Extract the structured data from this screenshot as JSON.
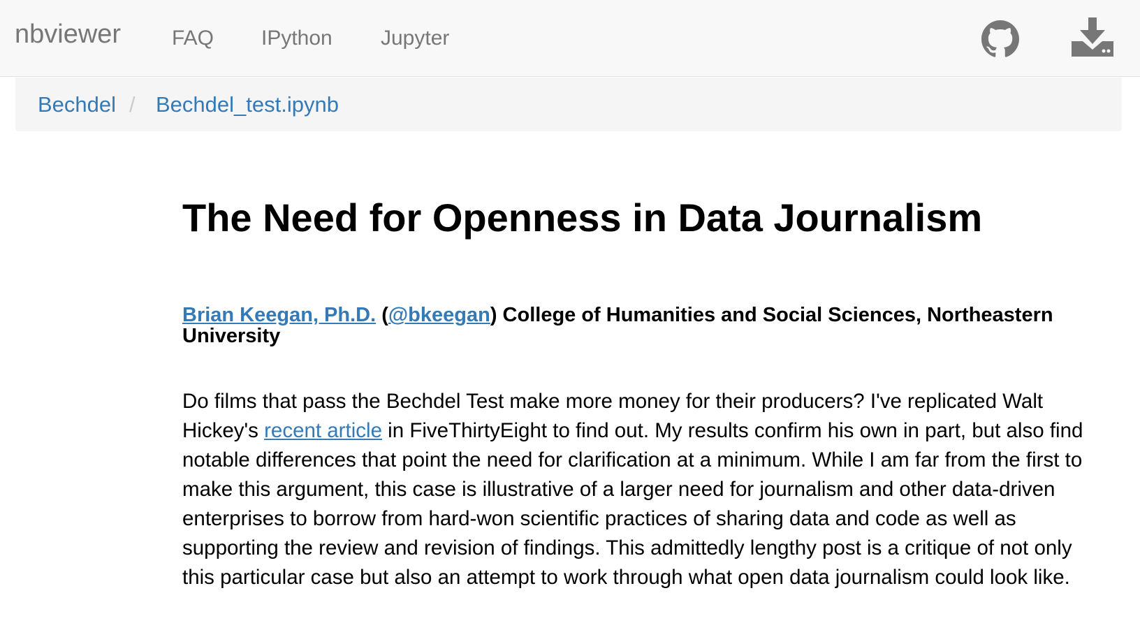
{
  "navbar": {
    "brand": "nbviewer",
    "links": [
      {
        "label": "FAQ"
      },
      {
        "label": "IPython"
      },
      {
        "label": "Jupyter"
      }
    ],
    "icons": [
      "github-icon",
      "download-icon"
    ]
  },
  "breadcrumb": {
    "items": [
      "Bechdel",
      "Bechdel_test.ipynb"
    ],
    "separator": "/"
  },
  "article": {
    "title": "The Need for Openness in Data Journalism",
    "byline": {
      "author_link": "Brian Keegan, Ph.D.",
      "open_paren": " (",
      "handle_link": "@bkeegan",
      "affiliation": ") College of Humanities and Social Sciences, Northeastern University"
    },
    "intro": {
      "before_link": "Do films that pass the Bechdel Test make more money for their producers? I've replicated Walt Hickey's ",
      "link": "recent article",
      "after_link": " in FiveThirtyEight to find out. My results confirm his own in part, but also find notable differences that point the need for clarification at a minimum. While I am far from the first to make this argument, this case is illustrative of a larger need for journalism and other data-driven enterprises to borrow from hard-won scientific practices of sharing data and code as well as supporting the review and revision of findings. This admittedly lengthy post is a critique of not only this particular case but also an attempt to work through what open data journalism could look like."
    }
  },
  "colors": {
    "navbar_bg": "#f8f8f8",
    "nav_text": "#777777",
    "link": "#337ab7",
    "breadcrumb_bg": "#f5f5f5"
  }
}
